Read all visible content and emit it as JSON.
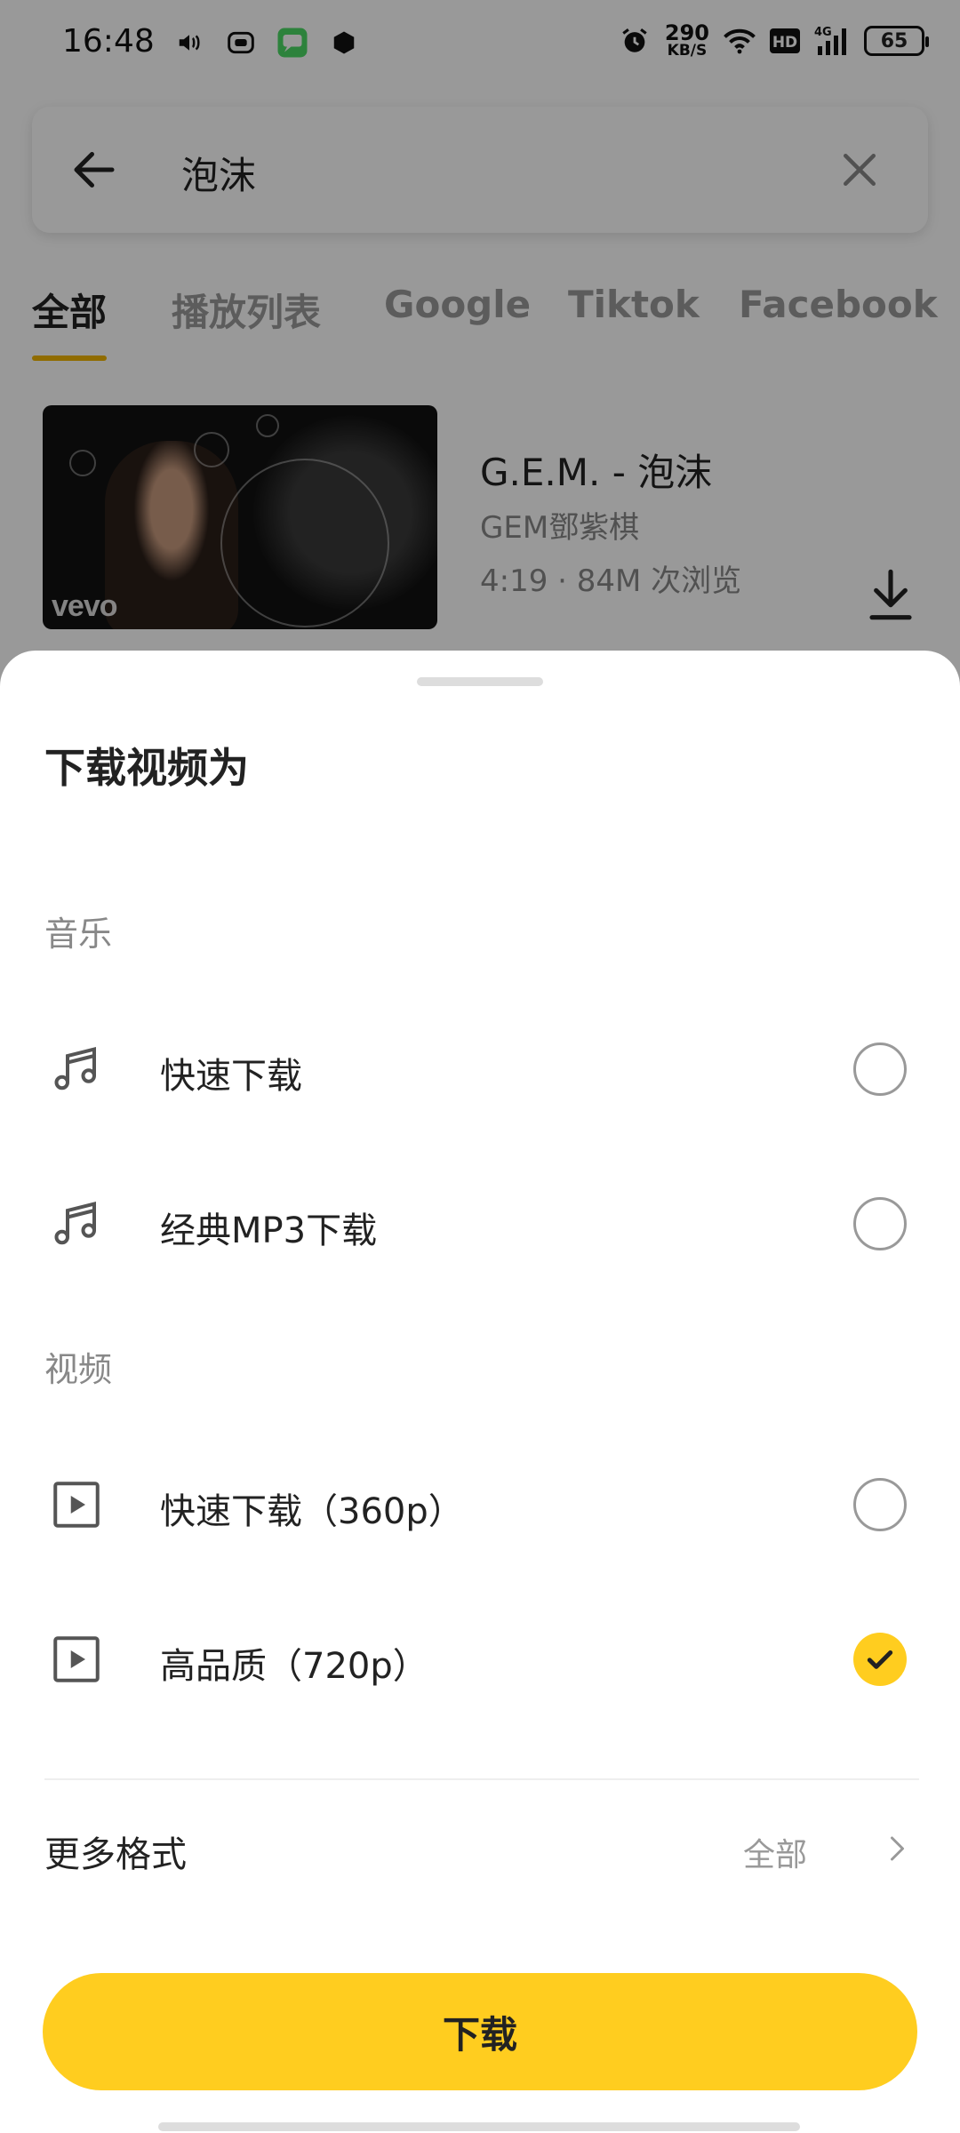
{
  "status_bar": {
    "time": "16:48",
    "net_speed_value": "290",
    "net_speed_unit": "KB/S",
    "hd": "HD",
    "network": "4G",
    "battery": "65"
  },
  "search": {
    "query": "泡沫"
  },
  "tabs": [
    {
      "label": "全部",
      "active": true
    },
    {
      "label": "播放列表",
      "active": false
    },
    {
      "label": "Google",
      "active": false
    },
    {
      "label": "Tiktok",
      "active": false
    },
    {
      "label": "Facebook",
      "active": false
    }
  ],
  "video": {
    "title": "G.E.M. - 泡沫",
    "channel": "GEM鄧紫棋",
    "meta": "4:19 · 84M 次浏览",
    "thumb_logo": "vevo"
  },
  "sheet": {
    "title": "下载视频为",
    "music_section": "音乐",
    "video_section": "视频",
    "options": [
      {
        "label": "快速下载",
        "icon": "music-note-icon",
        "selected": false
      },
      {
        "label": "经典MP3下载",
        "icon": "music-note-icon",
        "selected": false
      },
      {
        "label": "快速下载（360p）",
        "icon": "play-box-icon",
        "selected": false
      },
      {
        "label": "高品质（720p）",
        "icon": "play-box-icon",
        "selected": true
      }
    ],
    "more_formats_label": "更多格式",
    "more_formats_value": "全部",
    "download_button": "下载"
  },
  "colors": {
    "accent": "#ffcd1f",
    "tab_underline": "#f0b400"
  }
}
